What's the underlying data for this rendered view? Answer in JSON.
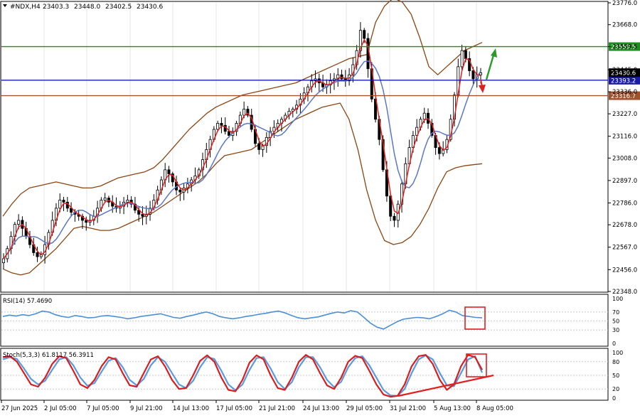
{
  "chart_data": {
    "type": "candlestick",
    "title": "#NDX,H4",
    "ohlc": {
      "open": "23403.3",
      "high": "23448.0",
      "low": "23402.5",
      "close": "23430.6"
    },
    "y_ticks": [
      "23776.0",
      "23668.0",
      "23559.5",
      "23445.0",
      "23336.0",
      "23227.0",
      "23116.0",
      "23008.0",
      "22897.0",
      "22786.0",
      "22678.0",
      "22567.0",
      "22456.0",
      "22348.0"
    ],
    "ylim": [
      22348.0,
      23776.0
    ],
    "x_ticks": [
      "27 Jun 2025",
      "2 Jul 05:00",
      "7 Jul 05:00",
      "9 Jul 21:00",
      "14 Jul 13:00",
      "17 Jul 05:00",
      "21 Jul 21:00",
      "24 Jul 13:00",
      "29 Jul 05:00",
      "31 Jul 21:00",
      "5 Aug 13:00",
      "8 Aug 05:00"
    ],
    "levels": [
      {
        "label": "23559.5",
        "value": 23559.5,
        "color": "#1e8c1e"
      },
      {
        "label": "23393.2",
        "value": 23393.2,
        "color": "#1a1aa8"
      },
      {
        "label": "23316.7",
        "value": 23316.7,
        "color": "#a0522d"
      }
    ],
    "price_label": {
      "label": "23430.6",
      "value": 23430.6
    },
    "closes": [
      22510,
      22560,
      22620,
      22680,
      22700,
      22660,
      22620,
      22580,
      22540,
      22520,
      22530,
      22580,
      22640,
      22700,
      22760,
      22800,
      22790,
      22760,
      22740,
      22730,
      22720,
      22700,
      22690,
      22700,
      22720,
      22760,
      22800,
      22810,
      22790,
      22770,
      22760,
      22770,
      22790,
      22800,
      22780,
      22750,
      22730,
      22720,
      22730,
      22760,
      22800,
      22850,
      22900,
      22950,
      22930,
      22890,
      22850,
      22840,
      22860,
      22880,
      22900,
      22920,
      22950,
      23000,
      23050,
      23100,
      23150,
      23180,
      23170,
      23140,
      23120,
      23140,
      23180,
      23220,
      23250,
      23220,
      23150,
      23080,
      23050,
      23070,
      23110,
      23140,
      23160,
      23180,
      23200,
      23220,
      23240,
      23250,
      23270,
      23300,
      23330,
      23360,
      23390,
      23400,
      23380,
      23360,
      23370,
      23390,
      23400,
      23420,
      23400,
      23390,
      23420,
      23470,
      23540,
      23640,
      23600,
      23450,
      23300,
      23200,
      23100,
      22950,
      22820,
      22720,
      22700,
      22780,
      22880,
      22980,
      23060,
      23120,
      23160,
      23200,
      23230,
      23180,
      23120,
      23060,
      23030,
      23050,
      23100,
      23200,
      23320,
      23460,
      23540,
      23500,
      23440,
      23400,
      23420,
      23430
    ],
    "bollinger": {
      "upper": [
        22720,
        22780,
        22830,
        22860,
        22870,
        22880,
        22890,
        22880,
        22870,
        22860,
        22860,
        22870,
        22890,
        22910,
        22920,
        22930,
        22940,
        22960,
        23000,
        23050,
        23100,
        23150,
        23190,
        23230,
        23260,
        23280,
        23300,
        23320,
        23330,
        23340,
        23350,
        23360,
        23370,
        23380,
        23400,
        23420,
        23440,
        23460,
        23480,
        23500,
        23510,
        23520,
        23680,
        23760,
        23800,
        23780,
        23720,
        23600,
        23460,
        23420,
        23460,
        23500,
        23540,
        23560,
        23580
      ],
      "lower": [
        22460,
        22440,
        22430,
        22440,
        22480,
        22520,
        22560,
        22610,
        22660,
        22670,
        22660,
        22650,
        22650,
        22660,
        22680,
        22700,
        22720,
        22740,
        22770,
        22800,
        22830,
        22860,
        22890,
        22930,
        22980,
        23020,
        23030,
        23040,
        23050,
        23080,
        23110,
        23140,
        23170,
        23200,
        23220,
        23240,
        23260,
        23270,
        23280,
        23200,
        23050,
        22850,
        22700,
        22600,
        22580,
        22590,
        22620,
        22680,
        22760,
        22860,
        22940,
        22960,
        22970,
        22975,
        22980
      ],
      "middle": [
        22590,
        22610,
        22630,
        22650,
        22670,
        22690,
        22710,
        22730,
        22740,
        22750,
        22755,
        22760,
        22770,
        22780,
        22790,
        22800,
        22820,
        22840,
        22870,
        22900,
        22930,
        22960,
        22990,
        23020,
        23060,
        23090,
        23110,
        23130,
        23150,
        23170,
        23190,
        23210,
        23230,
        23250,
        23280,
        23300,
        23320,
        23340,
        23360,
        23350,
        23280,
        23200,
        23160,
        23150,
        23160,
        23180,
        23200,
        23220,
        23240,
        23260,
        23280,
        23300,
        23320,
        23335,
        23345
      ]
    },
    "rsi": {
      "label": "RSI(14) 57.4690",
      "ticks": [
        "100",
        "70",
        "50",
        "30",
        "0"
      ],
      "values": [
        60,
        63,
        61,
        64,
        62,
        66,
        72,
        70,
        64,
        60,
        58,
        62,
        60,
        57,
        58,
        61,
        62,
        60,
        58,
        55,
        57,
        60,
        62,
        64,
        66,
        62,
        58,
        56,
        60,
        63,
        67,
        70,
        66,
        60,
        57,
        55,
        57,
        60,
        62,
        65,
        67,
        70,
        72,
        68,
        62,
        57,
        55,
        57,
        59,
        63,
        67,
        70,
        68,
        73,
        70,
        58,
        45,
        36,
        32,
        40,
        48,
        54,
        56,
        58,
        57,
        55,
        60,
        66,
        74,
        70,
        62,
        60,
        58,
        57
      ]
    },
    "stochastic": {
      "label": "Stoch(5,3,3) 61.8117 56.3911",
      "ticks": [
        "100",
        "80",
        "50",
        "20",
        "0"
      ],
      "main": [
        90,
        92,
        80,
        55,
        30,
        25,
        45,
        75,
        92,
        88,
        60,
        30,
        22,
        40,
        70,
        90,
        85,
        55,
        28,
        25,
        55,
        85,
        92,
        70,
        40,
        20,
        22,
        50,
        82,
        94,
        80,
        45,
        18,
        15,
        40,
        78,
        94,
        85,
        50,
        22,
        18,
        45,
        80,
        95,
        85,
        55,
        28,
        20,
        45,
        80,
        93,
        88,
        60,
        30,
        8,
        3,
        5,
        30,
        70,
        92,
        95,
        75,
        40,
        18,
        30,
        70,
        95,
        90,
        62
      ],
      "signal": [
        85,
        90,
        86,
        65,
        42,
        30,
        38,
        62,
        85,
        90,
        72,
        45,
        27,
        33,
        58,
        82,
        88,
        68,
        40,
        28,
        42,
        72,
        90,
        80,
        55,
        30,
        22,
        38,
        68,
        90,
        86,
        60,
        30,
        17,
        30,
        62,
        88,
        90,
        65,
        35,
        20,
        35,
        68,
        90,
        90,
        68,
        40,
        24,
        36,
        68,
        88,
        92,
        72,
        45,
        18,
        6,
        5,
        20,
        55,
        85,
        94,
        85,
        55,
        28,
        26,
        55,
        85,
        92,
        56
      ]
    }
  }
}
